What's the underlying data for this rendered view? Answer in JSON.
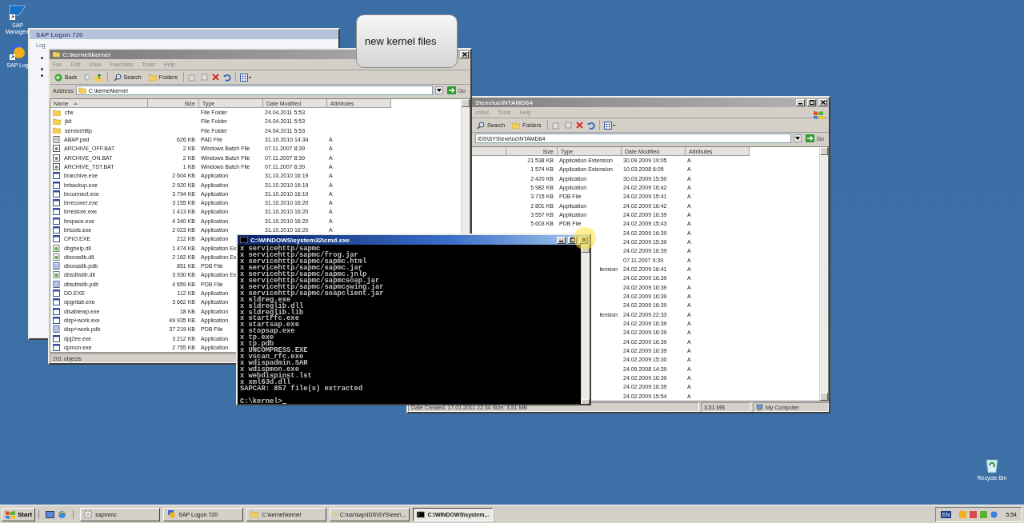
{
  "desktop_icons": [
    {
      "kind": "sap",
      "label": "SAP Managem"
    },
    {
      "kind": "logon",
      "label": "SAP Log"
    },
    {
      "kind": "bin",
      "label": "Recycle Bin"
    }
  ],
  "sap_logon": {
    "title": "SAP Logon 720",
    "active": false,
    "tab": "Log"
  },
  "ntamd_explorer": {
    "title": "S\\exe\\uc\\NTAMD64",
    "active": false,
    "menu": [
      "orites",
      "Tools",
      "Help"
    ],
    "toolbar": {
      "search": "Search",
      "folders": "Folders"
    },
    "address": {
      "value": "IDS\\SYS\\exe\\uc\\NTAMD64",
      "go": "Go"
    },
    "columns": [
      "Size",
      "Type",
      "Date Modified",
      "Attributes"
    ],
    "rows": [
      {
        "size": "21 538 KB",
        "type": "Application Extension",
        "date": "30.09.2009 19:05",
        "attributes": "A"
      },
      {
        "size": "1 574 KB",
        "type": "Application Extension",
        "date": "10.03.2008 6:05",
        "attributes": "A"
      },
      {
        "size": "2 420 KB",
        "type": "Application",
        "date": "30.03.2009 15:50",
        "attributes": "A"
      },
      {
        "size": "5 982 KB",
        "type": "Application",
        "date": "24.02.2009 16:42",
        "attributes": "A"
      },
      {
        "size": "3 715 KB",
        "type": "PDB File",
        "date": "24.02.2009 15:41",
        "attributes": "A"
      },
      {
        "size": "2 801 KB",
        "type": "Application",
        "date": "24.02.2009 16:42",
        "attributes": "A"
      },
      {
        "size": "3 557 KB",
        "type": "Application",
        "date": "24.02.2009 16:39",
        "attributes": "A"
      },
      {
        "size": "5 603 KB",
        "type": "PDB File",
        "date": "24.02.2009 15:43",
        "attributes": "A"
      },
      {
        "date": "24.02.2009 16:39",
        "attributes": "A"
      },
      {
        "date": "24.02.2009 15:39",
        "attributes": "A"
      },
      {
        "date": "24.02.2009 16:39",
        "attributes": "A"
      },
      {
        "date": "07.11.2007 9:39",
        "attributes": "A"
      },
      {
        "type": "tension",
        "date": "24.02.2009 16:41",
        "attributes": "A"
      },
      {
        "date": "24.02.2009 16:39",
        "attributes": "A"
      },
      {
        "date": "24.02.2009 16:39",
        "attributes": "A"
      },
      {
        "date": "24.02.2009 16:39",
        "attributes": "A"
      },
      {
        "date": "24.02.2009 16:39",
        "attributes": "A"
      },
      {
        "type": "tension",
        "date": "24.02.2009 22:33",
        "attributes": "A"
      },
      {
        "date": "24.02.2009 16:39",
        "attributes": "A"
      },
      {
        "date": "24.02.2009 16:39",
        "attributes": "A"
      },
      {
        "date": "24.02.2009 16:39",
        "attributes": "A"
      },
      {
        "date": "24.02.2009 16:39",
        "attributes": "A"
      },
      {
        "date": "24.02.2009 15:30",
        "attributes": "A"
      },
      {
        "date": "24.09.2008 14:39",
        "attributes": "A"
      },
      {
        "date": "24.02.2009 16:39",
        "attributes": "A"
      },
      {
        "date": "24.02.2009 16:39",
        "attributes": "A"
      },
      {
        "date": "24.02.2009 15:54",
        "attributes": "A"
      }
    ],
    "status": [
      "Date Created: 17.01.2011 22:34 Size: 3,51 MB",
      "3,51 MB",
      "My Computer"
    ]
  },
  "kernel_explorer": {
    "title": "C:\\kernel\\kernel",
    "active": false,
    "menu": [
      "File",
      "Edit",
      "View",
      "Favorites",
      "Tools",
      "Help"
    ],
    "toolbar": {
      "back": "Back",
      "search": "Search",
      "folders": "Folders"
    },
    "address": {
      "label": "Address",
      "value": "C:\\kernel\\kernel",
      "go": "Go"
    },
    "columns": [
      "Name",
      "Size",
      "Type",
      "Date Modified",
      "Attributes"
    ],
    "rows": [
      {
        "kind": "folder",
        "name": "cfw",
        "type": "File Folder",
        "date": "24.04.2011 5:53"
      },
      {
        "kind": "folder",
        "name": "jkit",
        "type": "File Folder",
        "date": "24.04.2011 5:53"
      },
      {
        "kind": "folder",
        "name": "servicehttp",
        "type": "File Folder",
        "date": "24.04.2011 5:53"
      },
      {
        "kind": "file",
        "name": "ABAP.pad",
        "size": "626 KB",
        "type": "PAD File",
        "date": "31.10.2010 14:34",
        "attributes": "A"
      },
      {
        "kind": "bat",
        "name": "ARCHIVE_OFF.BAT",
        "size": "2 KB",
        "type": "Windows Batch File",
        "date": "07.11.2007 8:39",
        "attributes": "A"
      },
      {
        "kind": "bat",
        "name": "ARCHIVE_ON.BAT",
        "size": "2 KB",
        "type": "Windows Batch File",
        "date": "07.11.2007 8:39",
        "attributes": "A"
      },
      {
        "kind": "bat",
        "name": "ARCHIVE_TST.BAT",
        "size": "1 KB",
        "type": "Windows Batch File",
        "date": "07.11.2007 8:39",
        "attributes": "A"
      },
      {
        "kind": "exe",
        "name": "brarchive.exe",
        "size": "2 604 KB",
        "type": "Application",
        "date": "31.10.2010 16:19",
        "attributes": "A"
      },
      {
        "kind": "exe",
        "name": "brbackup.exe",
        "size": "2 920 KB",
        "type": "Application",
        "date": "31.10.2010 16:19",
        "attributes": "A"
      },
      {
        "kind": "exe",
        "name": "brconnect.exe",
        "size": "3 794 KB",
        "type": "Application",
        "date": "31.10.2010 16:19",
        "attributes": "A"
      },
      {
        "kind": "exe",
        "name": "brrecover.exe",
        "size": "3 155 KB",
        "type": "Application",
        "date": "31.10.2010 16:20",
        "attributes": "A"
      },
      {
        "kind": "exe",
        "name": "brrestore.exe",
        "size": "1 413 KB",
        "type": "Application",
        "date": "31.10.2010 16:20",
        "attributes": "A"
      },
      {
        "kind": "exe",
        "name": "brspace.exe",
        "size": "4 340 KB",
        "type": "Application",
        "date": "31.10.2010 16:20",
        "attributes": "A"
      },
      {
        "kind": "exe",
        "name": "brtools.exe",
        "size": "2 023 KB",
        "type": "Application",
        "date": "31.10.2010 16:20",
        "attributes": "A"
      },
      {
        "kind": "exe",
        "name": "CPIO.EXE",
        "size": "212 KB",
        "type": "Application"
      },
      {
        "kind": "dll",
        "name": "dbghelp.dll",
        "size": "1 474 KB",
        "type": "Application Ex"
      },
      {
        "kind": "dll",
        "name": "dboraslib.dll",
        "size": "2 162 KB",
        "type": "Application Ex"
      },
      {
        "kind": "pdb",
        "name": "dboraslib.pdb",
        "size": "851 KB",
        "type": "PDB File"
      },
      {
        "kind": "dll",
        "name": "dbsdbslib.dll",
        "size": "3 930 KB",
        "type": "Application Ex"
      },
      {
        "kind": "pdb",
        "name": "dbsdbslib.pdb",
        "size": "4 659 KB",
        "type": "PDB File"
      },
      {
        "kind": "exe",
        "name": "DD.EXE",
        "size": "112 KB",
        "type": "Application"
      },
      {
        "kind": "exe",
        "name": "dpgntab.exe",
        "size": "3 662 KB",
        "type": "Application"
      },
      {
        "kind": "exe",
        "name": "disablewp.exe",
        "size": "18 KB",
        "type": "Application"
      },
      {
        "kind": "exe",
        "name": "disp+work.exe",
        "size": "49 935 KB",
        "type": "Application"
      },
      {
        "kind": "pdb",
        "name": "disp+work.pdb",
        "size": "37 219 KB",
        "type": "PDB File"
      },
      {
        "kind": "exe",
        "name": "dpj2ee.exe",
        "size": "3 212 KB",
        "type": "Application"
      },
      {
        "kind": "exe",
        "name": "dpmon.exe",
        "size": "2 755 KB",
        "type": "Application"
      }
    ],
    "status": [
      "201 objects"
    ]
  },
  "cmd": {
    "title": "C:\\WINDOWS\\system32\\cmd.exe",
    "active": true,
    "lines": [
      "x servicehttp/sapmc",
      "x servicehttp/sapmc/frog.jar",
      "x servicehttp/sapmc/sapmc.html",
      "x servicehttp/sapmc/sapmc.jar",
      "x servicehttp/sapmc/sapmc.jnlp",
      "x servicehttp/sapmc/sapmcsoap.jar",
      "x servicehttp/sapmc/sapmcswing.jar",
      "x servicehttp/sapmc/soapclient.jar",
      "x sldreg.exe",
      "x sldreglib.dll",
      "x sldreglib.lib",
      "x startrfc.exe",
      "x startsap.exe",
      "x stopsap.exe",
      "x tp.exe",
      "x tp.pdb",
      "x UNCOMPRESS.EXE",
      "x vscan_rfc.exe",
      "x wdispadmin.SAR",
      "x wdispmon.exe",
      "x webdispinst.lst",
      "x xml63d.dll",
      "SAPCAR: 857 file(s) extracted"
    ],
    "prompt": "C:\\kernel>"
  },
  "callout": "new kernel files",
  "taskbar": {
    "start": "Start",
    "tasks": [
      {
        "kind": "mmc",
        "label": "sapmmc",
        "selected": false
      },
      {
        "kind": "logon",
        "label": "SAP Logon 720",
        "selected": false
      },
      {
        "kind": "folder",
        "label": "C:\\kernel\\kernel",
        "selected": false
      },
      {
        "kind": "folder",
        "label": "C:\\usr\\sap\\IDS\\SYS\\exe\\...",
        "selected": false
      },
      {
        "kind": "cmd",
        "label": "C:\\WINDOWS\\system...",
        "selected": true
      }
    ],
    "language": "EN",
    "clock": "5:54"
  }
}
